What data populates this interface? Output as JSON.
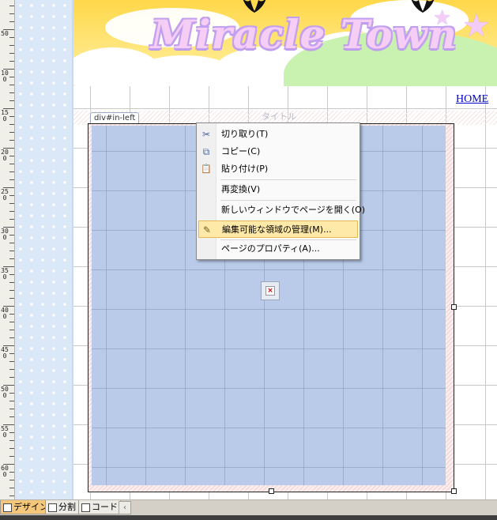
{
  "header": {
    "site_title": "Miracle Town",
    "home_link": "HOME"
  },
  "design": {
    "selected_tag": "div#in-left",
    "title_placeholder": "タイトル",
    "broken_image_mark": "×"
  },
  "ruler": {
    "labels": [
      "50",
      "100",
      "150",
      "200",
      "250",
      "300",
      "350",
      "400",
      "450",
      "500",
      "550",
      "600"
    ]
  },
  "context_menu": {
    "items": [
      {
        "label": "切り取り(T)",
        "icon": "scissors-icon",
        "glyph": "✂"
      },
      {
        "label": "コピー(C)",
        "icon": "copy-icon",
        "glyph": "⧉"
      },
      {
        "label": "貼り付け(P)",
        "icon": "paste-icon",
        "glyph": "📋"
      },
      {
        "label": "再変換(V)",
        "icon": "",
        "glyph": ""
      },
      {
        "label": "新しいウィンドウでページを開く(O)",
        "icon": "",
        "glyph": ""
      },
      {
        "label": "編集可能な領域の管理(M)...",
        "icon": "editable-region-icon",
        "glyph": "✎"
      },
      {
        "label": "ページのプロパティ(A)...",
        "icon": "",
        "glyph": ""
      }
    ],
    "highlighted_index": 5
  },
  "view_tabs": [
    {
      "label": "デザイン",
      "active": true
    },
    {
      "label": "分割",
      "active": false
    },
    {
      "label": "コード",
      "active": false
    }
  ],
  "colors": {
    "accent_highlight": "#ffe9a8",
    "selection_fill": "#b9cbe9",
    "link": "#0000cc"
  }
}
